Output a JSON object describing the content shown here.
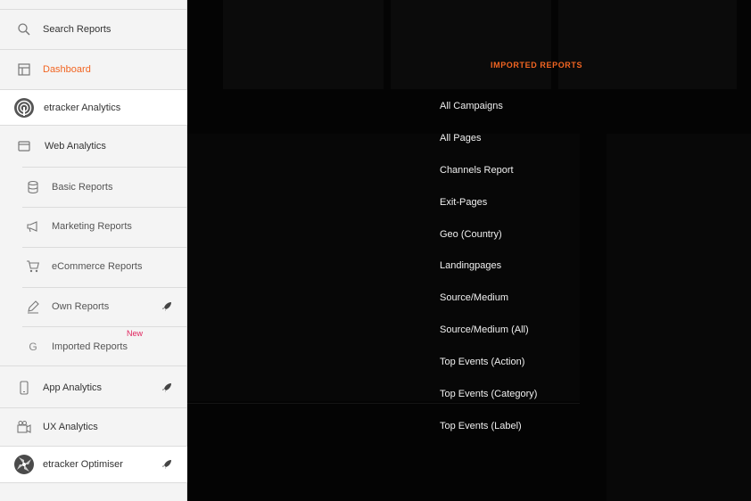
{
  "sidebar": {
    "search": "Search Reports",
    "dashboard": "Dashboard",
    "etracker_analytics": {
      "prefix": "etracker",
      "suffix": " Analytics"
    },
    "web_analytics": "Web Analytics",
    "sub": {
      "basic": "Basic Reports",
      "marketing": "Marketing Reports",
      "ecommerce": "eCommerce Reports",
      "own": "Own Reports",
      "imported": "Imported Reports",
      "imported_badge": "New"
    },
    "app_analytics": "App Analytics",
    "ux_analytics": "UX Analytics",
    "optimiser": "etracker Optimiser"
  },
  "menu": {
    "title": "IMPORTED REPORTS",
    "items": [
      "All Campaigns",
      "All Pages",
      "Channels Report",
      "Exit-Pages",
      "Geo (Country)",
      "Landingpages",
      "Source/Medium",
      "Source/Medium (All)",
      "Top Events (Action)",
      "Top Events (Category)",
      "Top Events (Label)"
    ]
  },
  "colors": {
    "accent": "#f26522",
    "badge": "#e0245e",
    "sidebar_bg": "#f4f4f4",
    "overlay_bg": "#040404"
  }
}
